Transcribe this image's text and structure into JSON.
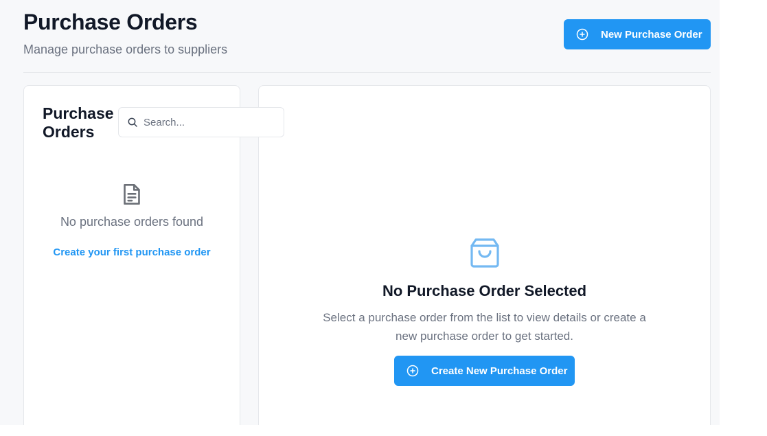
{
  "header": {
    "title": "Purchase Orders",
    "subtitle": "Manage purchase orders to suppliers",
    "new_button_label": "New Purchase Order",
    "new_button_icon": "plus-circle-icon"
  },
  "list_panel": {
    "title": "Purchase Orders",
    "search": {
      "placeholder": "Search...",
      "value": "",
      "icon": "search-icon"
    },
    "empty_icon": "document-icon",
    "empty_text": "No purchase orders found",
    "empty_link": "Create your first purchase order"
  },
  "detail_panel": {
    "empty_icon": "shopping-bag-icon",
    "title": "No Purchase Order Selected",
    "description": "Select a purchase order from the list to view details or create a new purchase order to get started.",
    "create_button_label": "Create New Purchase Order",
    "create_button_icon": "plus-circle-icon"
  },
  "colors": {
    "accent": "#2196f3",
    "page_background": "#f7f8fa",
    "muted_text": "#6b7280",
    "icon_muted": "#6b6f76",
    "icon_accent_light": "#74b9f2"
  }
}
